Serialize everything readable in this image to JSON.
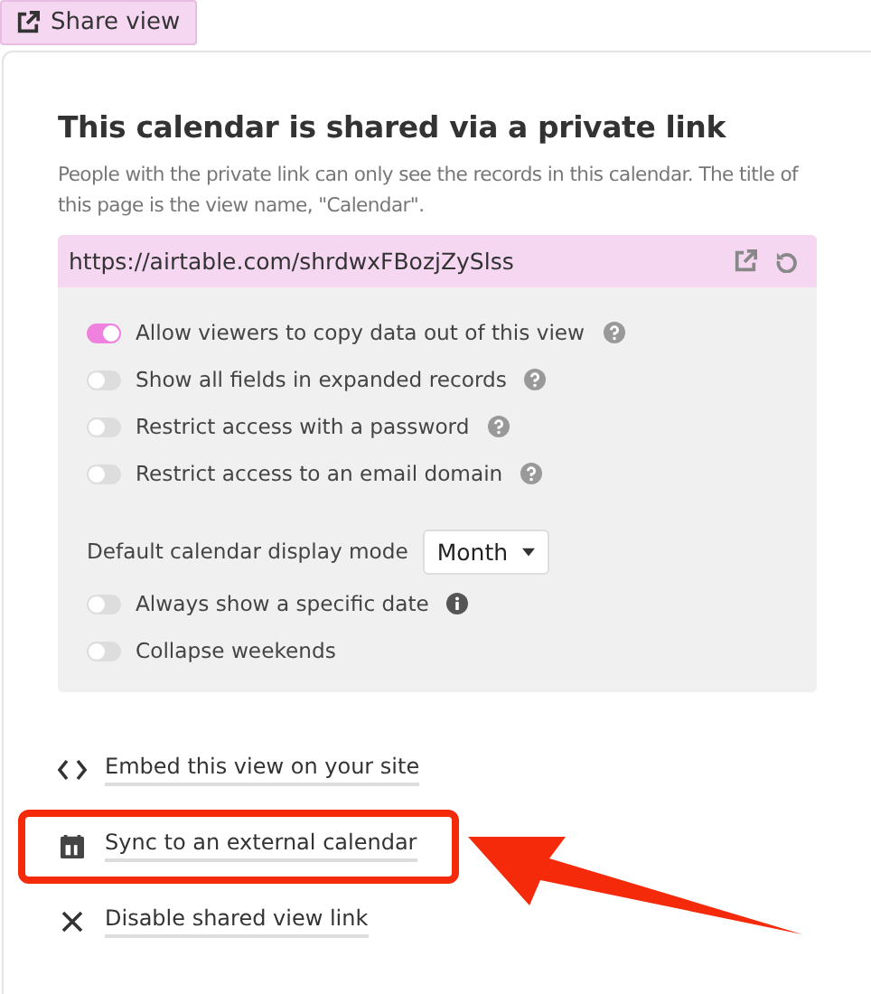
{
  "share_button": {
    "label": "Share view",
    "selected": true
  },
  "title": "This calendar is shared via a private link",
  "description": "People with the private link can only see the records in this calendar. The title of this page is the view name, \"Calendar\".",
  "link": {
    "url": "https://airtable.com/shrdwxFBozjZySlss"
  },
  "options": [
    {
      "kind": "toggle",
      "label": "Allow viewers to copy data out of this view",
      "on": true,
      "help": true
    },
    {
      "kind": "toggle",
      "label": "Show all fields in expanded records",
      "on": false,
      "help": true
    },
    {
      "kind": "toggle",
      "label": "Restrict access with a password",
      "on": false,
      "help": true
    },
    {
      "kind": "toggle",
      "label": "Restrict access to an email domain",
      "on": false,
      "help": true
    },
    {
      "kind": "select",
      "label": "Default calendar display mode",
      "value": "Month"
    },
    {
      "kind": "toggle",
      "label": "Always show a specific date",
      "on": false,
      "info": true
    },
    {
      "kind": "toggle",
      "label": "Collapse weekends",
      "on": false
    }
  ],
  "actions": [
    {
      "kind": "embed",
      "label": "Embed this view on your site",
      "highlighted": false
    },
    {
      "kind": "calendar",
      "label": "Sync to an external calendar",
      "highlighted": true
    },
    {
      "kind": "disable",
      "label": "Disable shared view link",
      "highlighted": false
    }
  ]
}
